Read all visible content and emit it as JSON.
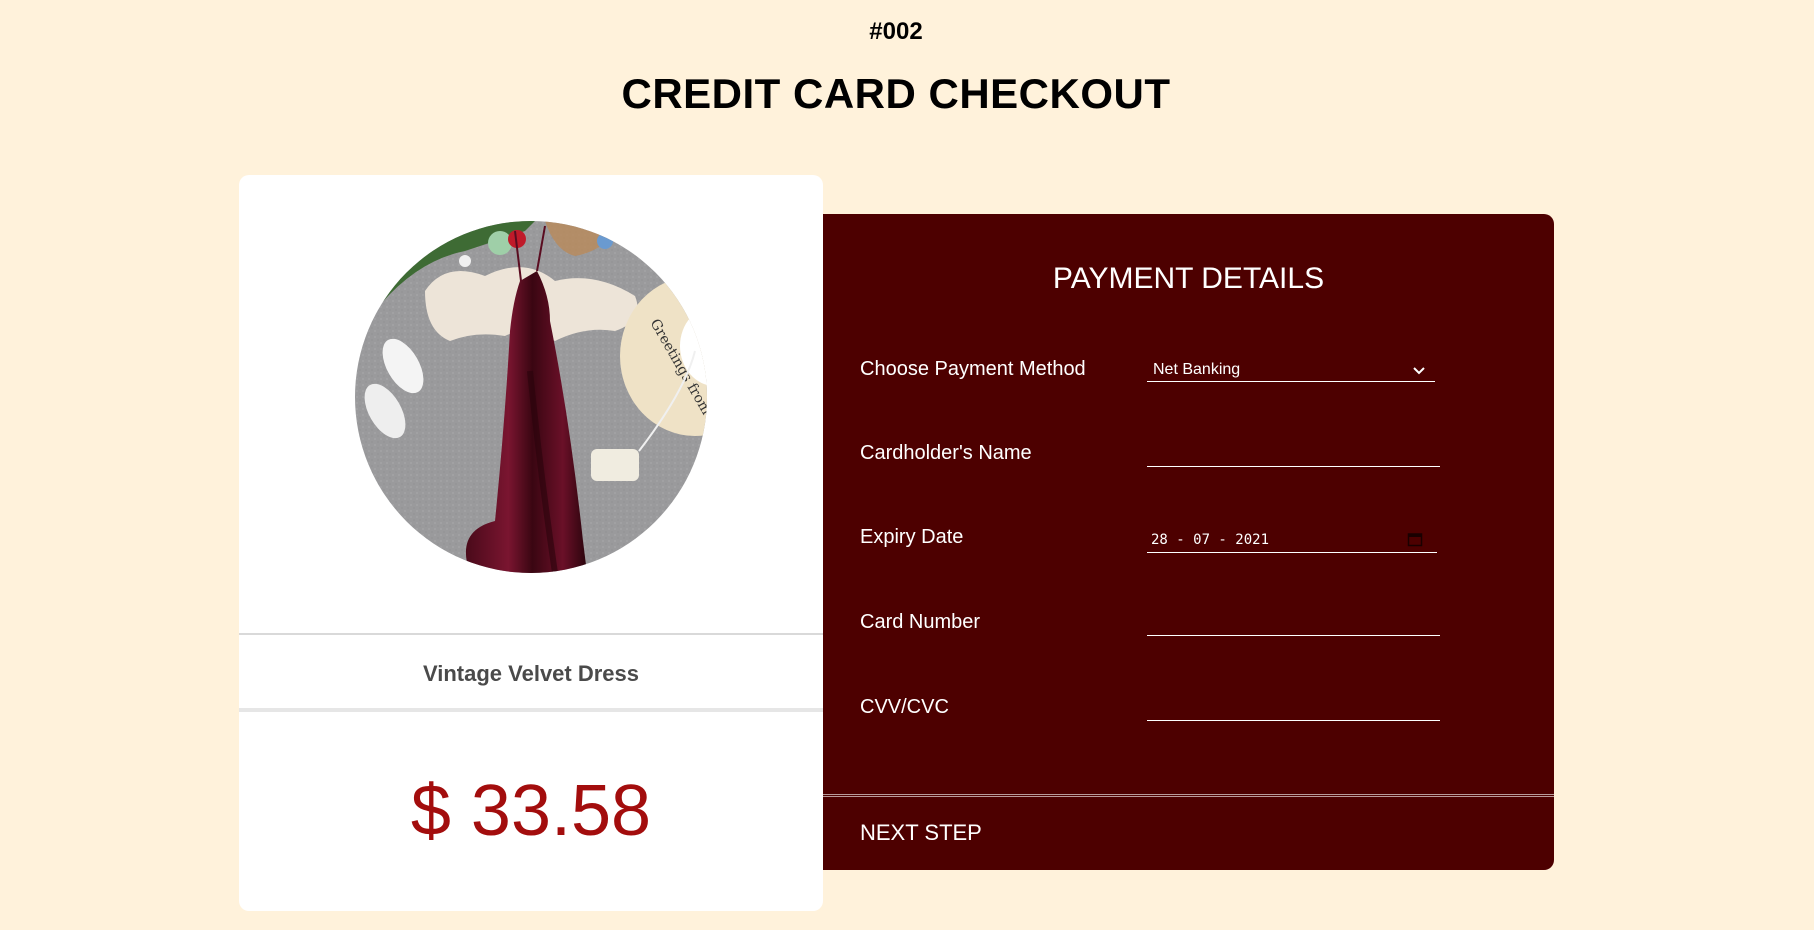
{
  "header": {
    "order_number": "#002",
    "title": "CREDIT CARD CHECKOUT"
  },
  "product": {
    "name": "Vintage Velvet Dress",
    "price": "$ 33.58",
    "image_icon": "dress-photo"
  },
  "payment": {
    "title": "PAYMENT DETAILS",
    "fields": {
      "method": {
        "label": "Choose Payment Method",
        "value": "Net Banking"
      },
      "cardholder": {
        "label": "Cardholder's Name",
        "value": ""
      },
      "expiry": {
        "label": "Expiry Date",
        "value": "28 - 07 - 2021"
      },
      "card_number": {
        "label": "Card Number",
        "value": ""
      },
      "cvv": {
        "label": "CVV/CVC",
        "value": ""
      }
    },
    "next_label": "NEXT STEP"
  },
  "colors": {
    "background": "#fff2db",
    "panel": "#4d0000",
    "price": "#a30d0d"
  }
}
